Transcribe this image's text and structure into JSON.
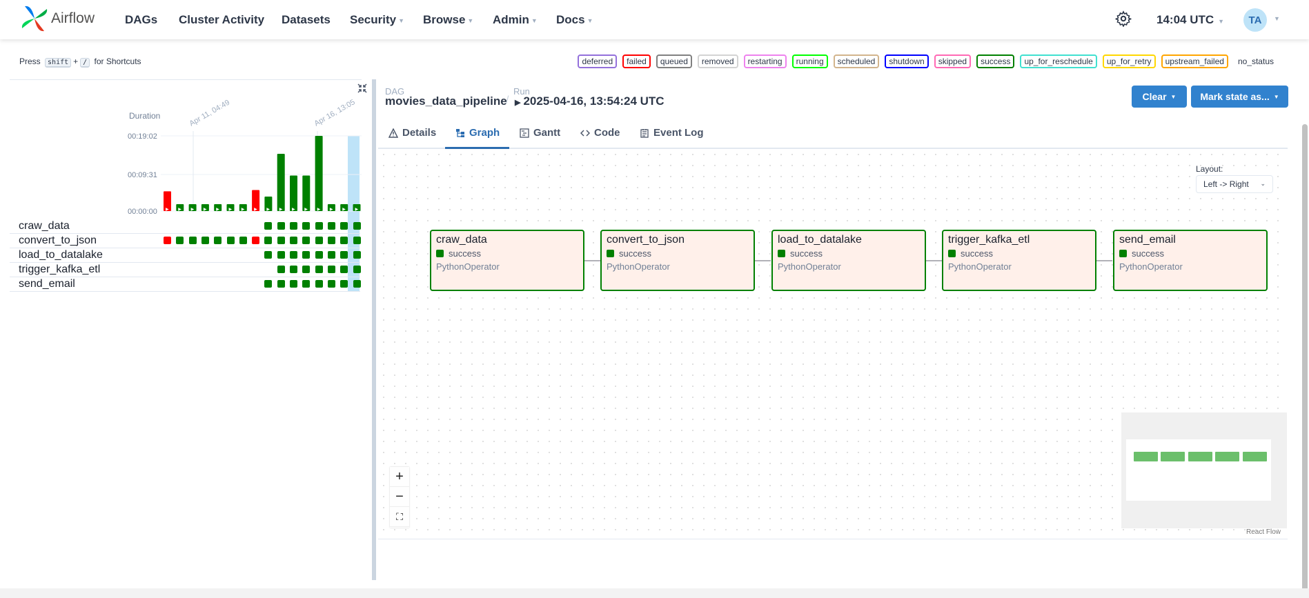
{
  "app": {
    "brand": "Airflow",
    "nav": [
      {
        "label": "DAGs",
        "caret": false
      },
      {
        "label": "Cluster Activity",
        "caret": false
      },
      {
        "label": "Datasets",
        "caret": false
      },
      {
        "label": "Security",
        "caret": true
      },
      {
        "label": "Browse",
        "caret": true
      },
      {
        "label": "Admin",
        "caret": true
      },
      {
        "label": "Docs",
        "caret": true
      }
    ],
    "time": "14:04 UTC",
    "avatar": "TA"
  },
  "shortcut": {
    "press": "Press",
    "key1": "shift",
    "plus": "+",
    "key2": "/",
    "suffix": "for Shortcuts"
  },
  "legend": [
    {
      "label": "deferred",
      "color": "#9370db"
    },
    {
      "label": "failed",
      "color": "#ff0000"
    },
    {
      "label": "queued",
      "color": "#808080"
    },
    {
      "label": "removed",
      "color": "#d3d3d3"
    },
    {
      "label": "restarting",
      "color": "#ee82ee"
    },
    {
      "label": "running",
      "color": "#00ff00"
    },
    {
      "label": "scheduled",
      "color": "#d2b48c"
    },
    {
      "label": "shutdown",
      "color": "#0000ff"
    },
    {
      "label": "skipped",
      "color": "#ff69b4"
    },
    {
      "label": "success",
      "color": "#008000"
    },
    {
      "label": "up_for_reschedule",
      "color": "#40e0d0"
    },
    {
      "label": "up_for_retry",
      "color": "#ffd700"
    },
    {
      "label": "upstream_failed",
      "color": "#ffa500"
    },
    {
      "label": "no_status",
      "color": "transparent"
    }
  ],
  "grid": {
    "duration_label": "Duration",
    "date_labels": [
      "Apr 11, 04:49",
      "Apr 16, 13:05"
    ],
    "y_ticks": [
      "00:19:02",
      "00:09:31",
      "00:00:00"
    ],
    "tasks": [
      "craw_data",
      "convert_to_json",
      "load_to_datalake",
      "trigger_kafka_etl",
      "send_email"
    ]
  },
  "chart_data": {
    "type": "bar",
    "title": "",
    "ylabel": "Duration",
    "ylim_seconds": [
      0,
      1142
    ],
    "runs": [
      {
        "duration_s": 300,
        "state": "failed"
      },
      {
        "duration_s": 40,
        "state": "success"
      },
      {
        "duration_s": 40,
        "state": "success"
      },
      {
        "duration_s": 40,
        "state": "success"
      },
      {
        "duration_s": 40,
        "state": "success"
      },
      {
        "duration_s": 40,
        "state": "success"
      },
      {
        "duration_s": 40,
        "state": "success"
      },
      {
        "duration_s": 320,
        "state": "failed"
      },
      {
        "duration_s": 220,
        "state": "success"
      },
      {
        "duration_s": 870,
        "state": "success"
      },
      {
        "duration_s": 540,
        "state": "success"
      },
      {
        "duration_s": 540,
        "state": "success"
      },
      {
        "duration_s": 1142,
        "state": "success"
      },
      {
        "duration_s": 40,
        "state": "success"
      },
      {
        "duration_s": 40,
        "state": "success"
      },
      {
        "duration_s": 40,
        "state": "success"
      }
    ],
    "task_states": {
      "craw_data": [
        "",
        "",
        "",
        "",
        "",
        "",
        "",
        "",
        "success",
        "success",
        "success",
        "success",
        "success",
        "success",
        "success",
        "success"
      ],
      "convert_to_json": [
        "failed",
        "success",
        "success",
        "success",
        "success",
        "success",
        "success",
        "failed",
        "success",
        "success",
        "success",
        "success",
        "success",
        "success",
        "success",
        "success"
      ],
      "load_to_datalake": [
        "",
        "",
        "",
        "",
        "",
        "",
        "",
        "",
        "success",
        "success",
        "success",
        "success",
        "success",
        "success",
        "success",
        "success"
      ],
      "trigger_kafka_etl": [
        "",
        "",
        "",
        "",
        "",
        "",
        "",
        "",
        "",
        "success",
        "success",
        "success",
        "success",
        "success",
        "success",
        "success"
      ],
      "send_email": [
        "",
        "",
        "",
        "",
        "",
        "",
        "",
        "",
        "success",
        "success",
        "success",
        "success",
        "success",
        "success",
        "success",
        "success"
      ]
    },
    "colors": {
      "success": "#008000",
      "failed": "#ff0000",
      "selected": "#bee3f8"
    }
  },
  "details": {
    "dag_label": "DAG",
    "dag_name": "movies_data_pipeline",
    "slash": "/",
    "run_label": "Run",
    "run_value": "2025-04-16, 13:54:24 UTC",
    "clear_btn": "Clear",
    "mark_btn": "Mark state as...",
    "tabs": [
      "Details",
      "Graph",
      "Gantt",
      "Code",
      "Event Log"
    ],
    "active_tab": "Graph"
  },
  "graph": {
    "layout_label": "Layout:",
    "layout_value": "Left -> Right",
    "nodes": [
      {
        "name": "craw_data",
        "state": "success",
        "operator": "PythonOperator"
      },
      {
        "name": "convert_to_json",
        "state": "success",
        "operator": "PythonOperator"
      },
      {
        "name": "load_to_datalake",
        "state": "success",
        "operator": "PythonOperator"
      },
      {
        "name": "trigger_kafka_etl",
        "state": "success",
        "operator": "PythonOperator"
      },
      {
        "name": "send_email",
        "state": "success",
        "operator": "PythonOperator"
      }
    ],
    "zoom_in": "+",
    "zoom_out": "−",
    "fit": "⛶",
    "attribution": "React Flow"
  }
}
